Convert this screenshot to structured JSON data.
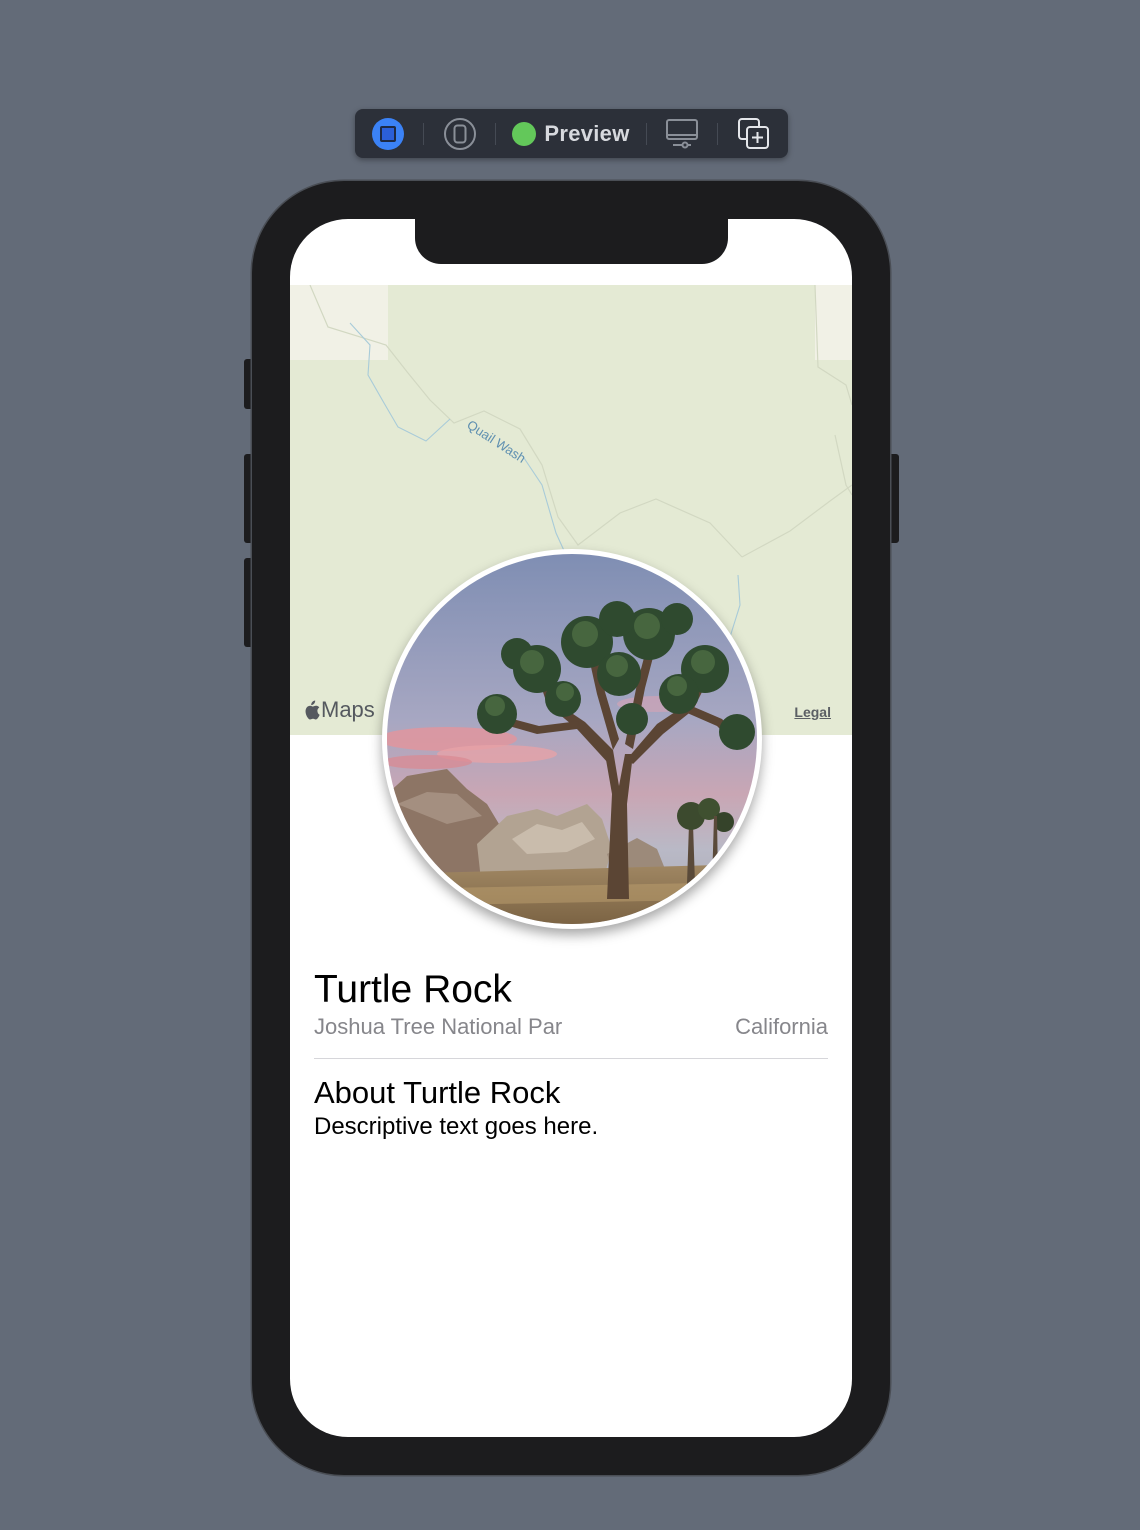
{
  "toolbar": {
    "live_button_icon": "live-preview-icon",
    "device_button_icon": "device-icon",
    "preview_label": "Preview",
    "preview_status_color": "#63c85a",
    "display_button_icon": "display-settings-icon",
    "duplicate_button_icon": "duplicate-preview-icon"
  },
  "map": {
    "water_label": "Quail Wash",
    "attribution": "Maps",
    "legal_label": "Legal"
  },
  "landmark": {
    "name": "Turtle Rock",
    "park": "Joshua Tree National Par",
    "state": "California",
    "about_title": "About Turtle Rock",
    "description": "Descriptive text goes here."
  }
}
